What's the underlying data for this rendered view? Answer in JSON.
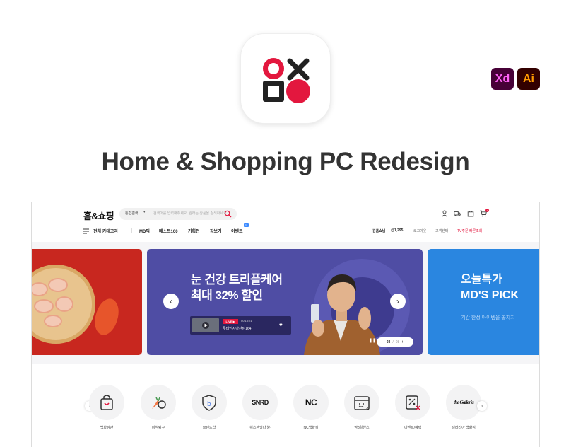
{
  "presentation": {
    "title": "Home & Shopping PC Redesign",
    "tools": {
      "xd": "Xd",
      "ai": "Ai"
    }
  },
  "colors": {
    "brand_red": "#e3173e",
    "hero_purple": "#4f4da4",
    "hero_blue": "#2a86e0",
    "food_red": "#c8271f"
  },
  "header": {
    "logo": "홈&쇼핑",
    "search": {
      "category": "통합검색",
      "placeholder": "검색어를 입력해주세요. 원하는 상품을 검색하세요"
    },
    "icons": [
      "user-icon",
      "truck-icon",
      "bag-icon",
      "cart-icon"
    ],
    "cart_count": "1",
    "all_categories": "전체 카테고리",
    "nav": [
      "MD픽",
      "베스트100",
      "기획전",
      "장보기",
      "이벤트"
    ],
    "nav_new_badge": "N",
    "user_greeting": "김홈쇼님",
    "points": "@1,295",
    "util_links": [
      "로그아웃",
      "고객센터",
      "TV주문 빠른조회"
    ]
  },
  "hero": {
    "main_title_line1": "눈 건강 트리플케어",
    "main_title_line2": "최대 32% 할인",
    "live": {
      "tag": "LIVE ▶",
      "time": "00:15:21",
      "title": "루테인지아잔틴164"
    },
    "pager": {
      "current": "03",
      "separator": "/",
      "total": "08",
      "plus": "+"
    },
    "right_title_line1": "오늘특가",
    "right_title_line2": "MD'S PICK",
    "right_sub": "기간 한정 아이템을 놓치지"
  },
  "categories": [
    {
      "label": "백화점관",
      "icon": "shopping-bag-icon"
    },
    {
      "label": "미식탐구",
      "icon": "carrot-apple-icon"
    },
    {
      "label": "브랜드샵",
      "icon": "brand-shield-icon"
    },
    {
      "label": "쉬스팬딩다 外",
      "brand": "SNRD",
      "icon": "snrd-logo-icon"
    },
    {
      "label": "NC백화점",
      "brand": "NC",
      "icon": "nc-logo-icon"
    },
    {
      "label": "딱3일찬스",
      "icon": "calendar-3-icon"
    },
    {
      "label": "이벤트/혜택",
      "icon": "coupon-icon"
    },
    {
      "label": "갤러리아 백화점",
      "brand": "the Galleria",
      "icon": "galleria-logo-icon"
    }
  ]
}
